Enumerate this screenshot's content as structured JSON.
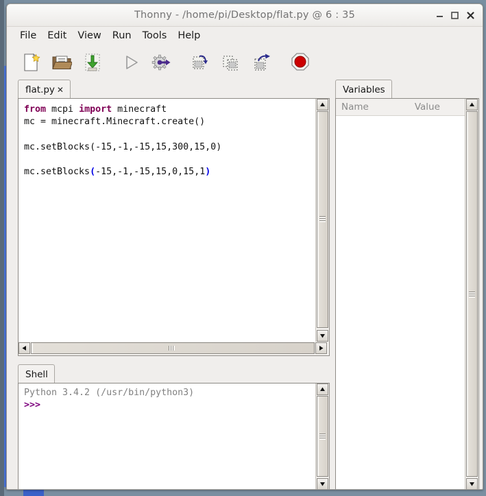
{
  "window": {
    "title": "Thonny  -  /home/pi/Desktop/flat.py  @  6 : 35",
    "app_name": "Thonny",
    "file_path": "/home/pi/Desktop/flat.py",
    "cursor_position": "6 : 35",
    "controls": {
      "minimize": "minimize-button",
      "maximize": "maximize-button",
      "close": "close-button"
    }
  },
  "menubar": {
    "items": [
      {
        "label": "File"
      },
      {
        "label": "Edit"
      },
      {
        "label": "View"
      },
      {
        "label": "Run"
      },
      {
        "label": "Tools"
      },
      {
        "label": "Help"
      }
    ]
  },
  "toolbar": {
    "buttons": [
      {
        "name": "new-file-icon",
        "tip": "New"
      },
      {
        "name": "open-file-icon",
        "tip": "Load"
      },
      {
        "name": "save-file-icon",
        "tip": "Save"
      },
      {
        "name": "run-icon",
        "tip": "Run current script"
      },
      {
        "name": "debug-icon",
        "tip": "Debug current script"
      },
      {
        "name": "step-over-icon",
        "tip": "Step over"
      },
      {
        "name": "step-into-icon",
        "tip": "Step into"
      },
      {
        "name": "step-out-icon",
        "tip": "Step out"
      },
      {
        "name": "stop-icon",
        "tip": "Stop/Reset"
      }
    ]
  },
  "editor": {
    "tab_label": "flat.py",
    "tab_close_glyph": "✕",
    "code_lines": [
      {
        "segments": [
          {
            "text": "from",
            "style": "kw"
          },
          {
            "text": " mcpi ",
            "style": "plain"
          },
          {
            "text": "import",
            "style": "kw"
          },
          {
            "text": " minecraft",
            "style": "plain"
          }
        ]
      },
      {
        "segments": [
          {
            "text": "mc = minecraft.Minecraft.create()",
            "style": "plain"
          }
        ]
      },
      {
        "segments": [
          {
            "text": "",
            "style": "plain"
          }
        ]
      },
      {
        "segments": [
          {
            "text": "mc.setBlocks(-15,-1,-15,15,300,15,0)",
            "style": "plain"
          }
        ]
      },
      {
        "segments": [
          {
            "text": "",
            "style": "plain"
          }
        ]
      },
      {
        "segments": [
          {
            "text": "mc.setBlocks",
            "style": "plain"
          },
          {
            "text": "(",
            "style": "brk"
          },
          {
            "text": "-15,-1,-15,15,0,15,1",
            "style": "plain"
          },
          {
            "text": ")",
            "style": "brk"
          }
        ]
      }
    ]
  },
  "shell": {
    "tab_label": "Shell",
    "banner": "Python 3.4.2 (/usr/bin/python3)",
    "prompt": ">>>"
  },
  "variables": {
    "tab_label": "Variables",
    "columns": [
      "Name",
      "Value"
    ],
    "rows": []
  },
  "colors": {
    "window_bg": "#f0eeec",
    "title_text": "#737373",
    "keyword": "#7f0055",
    "bracket_match": "#0000e6",
    "shell_banner": "#808080",
    "shell_prompt": "#7d007d",
    "stop_red": "#cc0000",
    "debug_purple": "#4b2a8c",
    "desktop": "#7a8fa1"
  }
}
